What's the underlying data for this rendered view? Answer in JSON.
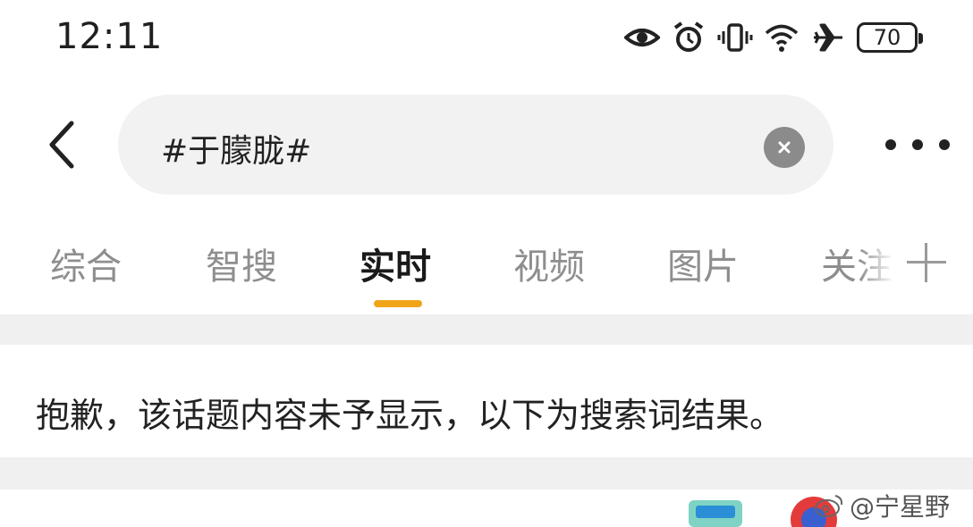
{
  "status_bar": {
    "time": "12:11",
    "battery": "70",
    "icons": [
      "eye-icon",
      "alarm-icon",
      "vibrate-icon",
      "wifi-icon",
      "airplane-icon",
      "battery-icon"
    ]
  },
  "search": {
    "query": "#于朦胧#",
    "back_icon": "chevron-left-icon",
    "clear_icon": "close-circle-icon",
    "more_icon": "more-dots-icon"
  },
  "tabs": {
    "items": [
      {
        "label": "综合",
        "active": false
      },
      {
        "label": "智搜",
        "active": false
      },
      {
        "label": "实时",
        "active": true
      },
      {
        "label": "视频",
        "active": false
      },
      {
        "label": "图片",
        "active": false
      },
      {
        "label": "关注",
        "active": false
      }
    ],
    "indicator_color": "#f0a519",
    "add_icon": "plus-icon"
  },
  "notice": {
    "text": "抱歉，该话题内容未予显示，以下为搜索词结果。"
  },
  "watermark": {
    "text": "@宁星野"
  }
}
